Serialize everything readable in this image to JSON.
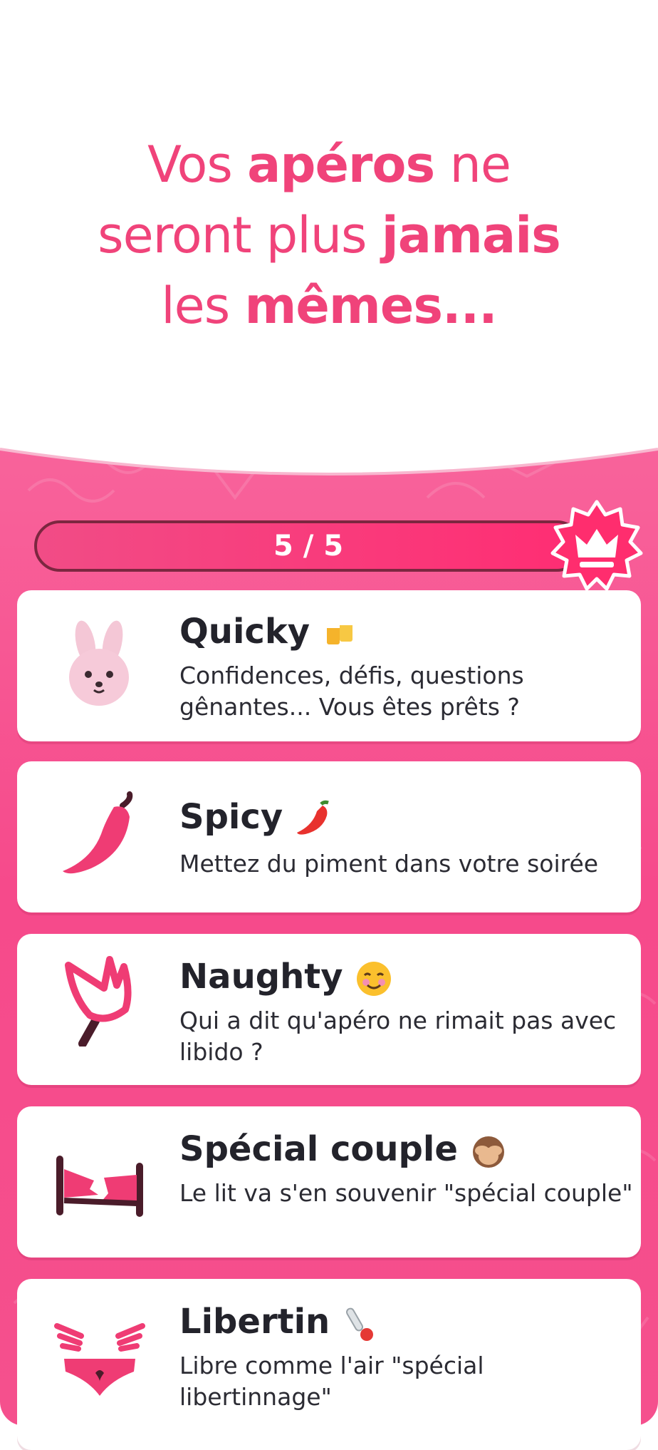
{
  "headline": {
    "line1": {
      "a": "Vos ",
      "b": "apéros",
      "c": " ne"
    },
    "line2": {
      "a": "seront plus ",
      "b": "jamais"
    },
    "line3": {
      "a": "les ",
      "b": "mêmes..."
    }
  },
  "progress": {
    "label": "5 / 5",
    "value": 5,
    "max": 5
  },
  "colors": {
    "brand_pink": "#f0437a",
    "panel_pink": "#f64a8b",
    "dark": "#23232b"
  },
  "packs": [
    {
      "title": "Quicky",
      "emoji": "beer-mugs-emoji",
      "icon": "bunny-icon",
      "description": "Confidences, défis, questions gênantes... Vous êtes prêts ?"
    },
    {
      "title": "Spicy",
      "emoji": "chili-pepper-emoji",
      "icon": "chili-icon",
      "description": "Mettez du piment dans votre soirée"
    },
    {
      "title": "Naughty",
      "emoji": "smiling-face-emoji",
      "icon": "trident-icon",
      "description": "Qui a dit qu'apéro ne rimait pas avec libido ?"
    },
    {
      "title": "Spécial couple",
      "emoji": "see-no-evil-monkey-emoji",
      "icon": "broken-bed-icon",
      "description": "Le lit va s'en souvenir \"spécial couple\""
    },
    {
      "title": "Libertin",
      "emoji": "thermometer-emoji",
      "icon": "winged-panties-icon",
      "description": "Libre comme l'air \"spécial libertinnage\""
    }
  ]
}
